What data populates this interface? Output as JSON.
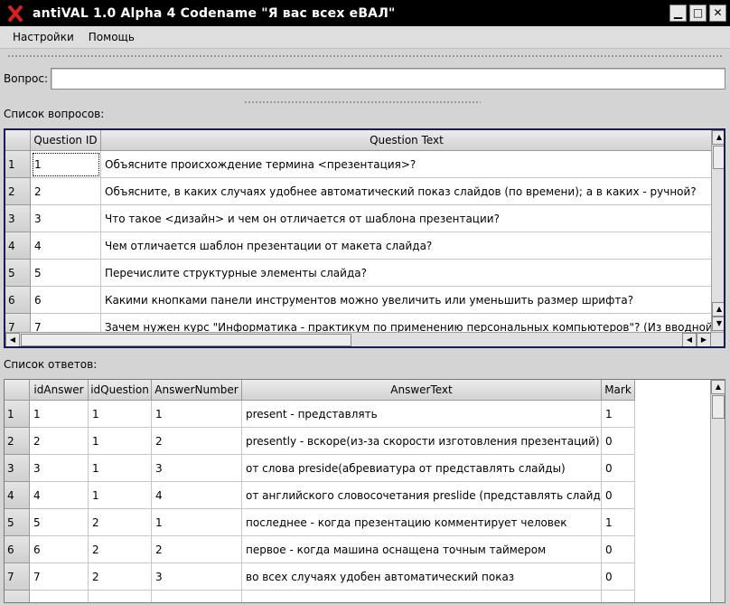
{
  "window": {
    "title": "antiVAL 1.0 Alpha 4 Codename \"Я вас всех еВАЛ\"",
    "minimize": "▁",
    "maximize": "□",
    "close": "✕"
  },
  "menu": {
    "items": [
      "Настройки",
      "Помощь"
    ]
  },
  "question_field": {
    "label": "Вопрос:",
    "value": ""
  },
  "questions": {
    "label": "Список вопросов:",
    "columns": [
      "Question ID",
      "Question Text"
    ],
    "rows": [
      {
        "n": "1",
        "id": "1",
        "text": "Объясните происхождение термина <презентация>?"
      },
      {
        "n": "2",
        "id": "2",
        "text": "Объясните, в каких случаях удобнее автоматический показ слайдов (по времени); а в каких - ручной?"
      },
      {
        "n": "3",
        "id": "3",
        "text": "Что такое <дизайн> и чем он отличается от шаблона презентации?"
      },
      {
        "n": "4",
        "id": "4",
        "text": "Чем отличается шаблон презентации от макета слайда?"
      },
      {
        "n": "5",
        "id": "5",
        "text": "Перечислите структурные элементы слайда?"
      },
      {
        "n": "6",
        "id": "6",
        "text": "Какими кнопками панели инструментов можно увеличить или уменьшить размер шрифта?"
      },
      {
        "n": "7",
        "id": "7",
        "text": "Зачем нужен курс \"Информатика - практикум по применению персональных компьютеров\"? (Из вводной лекции)"
      }
    ]
  },
  "answers": {
    "label": "Список ответов:",
    "columns": [
      "idAnswer",
      "idQuestion",
      "AnswerNumber",
      "AnswerText",
      "Mark"
    ],
    "rows": [
      {
        "n": "1",
        "idAnswer": "1",
        "idQuestion": "1",
        "num": "1",
        "text": "present - представлять",
        "mark": "1"
      },
      {
        "n": "2",
        "idAnswer": "2",
        "idQuestion": "1",
        "num": "2",
        "text": "presently - вскоре(из-за скорости изготовления презентаций)",
        "mark": "0"
      },
      {
        "n": "3",
        "idAnswer": "3",
        "idQuestion": "1",
        "num": "3",
        "text": "от слова preside(абревиатура от представлять слайды)",
        "mark": "0"
      },
      {
        "n": "4",
        "idAnswer": "4",
        "idQuestion": "1",
        "num": "4",
        "text": "от английского словосочетания preslide (представлять слайды)",
        "mark": "0"
      },
      {
        "n": "5",
        "idAnswer": "5",
        "idQuestion": "2",
        "num": "1",
        "text": "последнее - когда презентацию комментирует человек",
        "mark": "1"
      },
      {
        "n": "6",
        "idAnswer": "6",
        "idQuestion": "2",
        "num": "2",
        "text": "первое - когда машина оснащена точным таймером",
        "mark": "0"
      },
      {
        "n": "7",
        "idAnswer": "7",
        "idQuestion": "2",
        "num": "3",
        "text": "во всех случаях удобен автоматический показ",
        "mark": "0"
      }
    ]
  },
  "scroll": {
    "up": "▲",
    "down": "▼",
    "left": "◀",
    "right": "▶"
  }
}
